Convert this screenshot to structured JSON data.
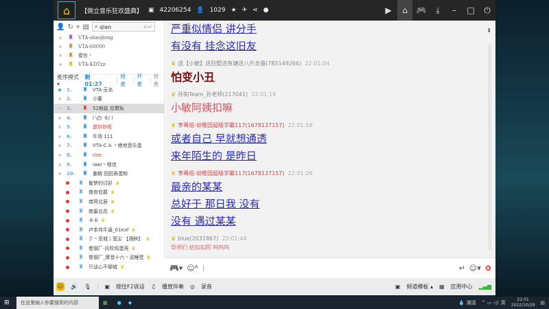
{
  "title": {
    "room": "【倒立音乐狂欢盛典】",
    "room_id": "42206254",
    "users": "1029"
  },
  "search": {
    "value": "qian"
  },
  "top_users": [
    "VTA-shaojiong",
    "VTA-60000",
    "春哲丶",
    "VTA-KDTzz"
  ],
  "mode": {
    "label": "麦序模式 ▾",
    "timer": "剩 01:27",
    "grab": "抢麦",
    "open": "开麦",
    "release": "抢麦"
  },
  "ranks": [
    {
      "n": "1.",
      "name": "VTA-无名"
    },
    {
      "n": "2.",
      "name": "小董"
    },
    {
      "n": "3.",
      "name": "52赫兹 应聘私"
    },
    {
      "n": "4.",
      "name": "l \\白 卡/ l"
    },
    {
      "n": "5.",
      "name": "是妙妙呢"
    },
    {
      "n": "6.",
      "name": "牛场 111"
    },
    {
      "n": "7.",
      "name": "VTA-C A 丶绝地音乐盒"
    },
    {
      "n": "8.",
      "name": "rise"
    },
    {
      "n": "9.",
      "name": "iwei丶嗯佳"
    },
    {
      "n": "10.",
      "name": "姜朝 回回表蛋粉"
    }
  ],
  "mic_users": [
    "衡梦的讨好",
    "南宫伯爵",
    "南冥北辰",
    "南巢北花",
    "卡卡",
    "卢本伟牛逼_01eaf",
    "卩丶圣城丨宽尘 【酒醉】",
    "卷钢厂-风吹鸡蛋壳",
    "卷钢厂_摩音十六丶说睡觉",
    "只谈心不聊城"
  ],
  "chat": {
    "top_lines": [
      "严重似情侣 讲分手",
      "有没有 挂念这旧友"
    ],
    "messages": [
      {
        "sender": "选【小敏】送别墅送鱼塘送八斤龙蛋(785149266)",
        "time": "22:01:04",
        "lines": [
          "怕变小丑"
        ]
      },
      {
        "sender": "孙狗Team_孙老师(217041)",
        "time": "22:01:19",
        "lines": [
          "小敏阿姨扣嘛"
        ]
      },
      {
        "sender": "李蓦组-幼稚园超级学霸117(1678137157)",
        "time": "22:01:19",
        "lines": [
          "或者自己 早就想通透",
          "来年陌生的 是昨日"
        ]
      },
      {
        "sender": "李蓦组-幼稚园超级学霸117(1678137157)",
        "time": "22:01:26",
        "lines": [
          "最亲的某某",
          "总好于 那日我 没有",
          "没有 遇过某某"
        ]
      },
      {
        "sender": "blue(2031867)",
        "time": "22:01:44",
        "lines": [
          "导师们 给扣扣阿 呜呜呜"
        ]
      }
    ]
  },
  "toolbar": {
    "f2": "按住F2说话",
    "accompany": "播放伴奏",
    "record": "录音",
    "template": "频道模板 ▴",
    "apps": "应用中心"
  },
  "taskbar": {
    "search": "在这里输入你要搜索的内容",
    "weather": "潮湿",
    "time": "22:01",
    "date": "2022/10/29",
    "lang": "英"
  }
}
